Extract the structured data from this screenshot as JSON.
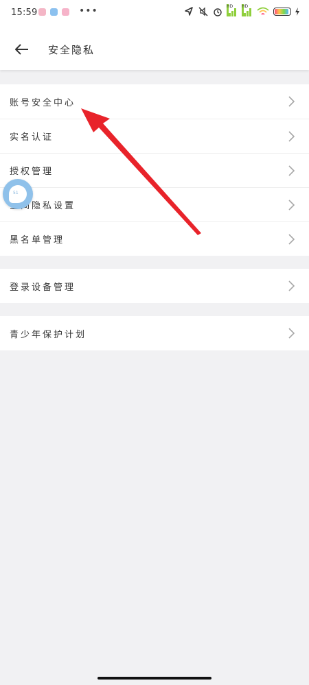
{
  "status_bar": {
    "time": "15:59",
    "more": "•••",
    "network_badge": "HD"
  },
  "nav": {
    "back_icon": "back-arrow-icon",
    "title": "安全隐私"
  },
  "groups": [
    {
      "items": [
        {
          "label": "账号安全中心"
        },
        {
          "label": "实名认证"
        },
        {
          "label": "授权管理"
        },
        {
          "label": "空间隐私设置"
        },
        {
          "label": "黑名单管理"
        }
      ]
    },
    {
      "items": [
        {
          "label": "登录设备管理"
        }
      ]
    },
    {
      "items": [
        {
          "label": "青少年保护计划"
        }
      ]
    }
  ],
  "floating_assistant": {
    "text": "51"
  },
  "annotation": {
    "color": "#e8232a"
  },
  "colors": {
    "background": "#f1f1f3",
    "card": "#ffffff",
    "text": "#333333",
    "chevron": "#a8a8a8"
  }
}
